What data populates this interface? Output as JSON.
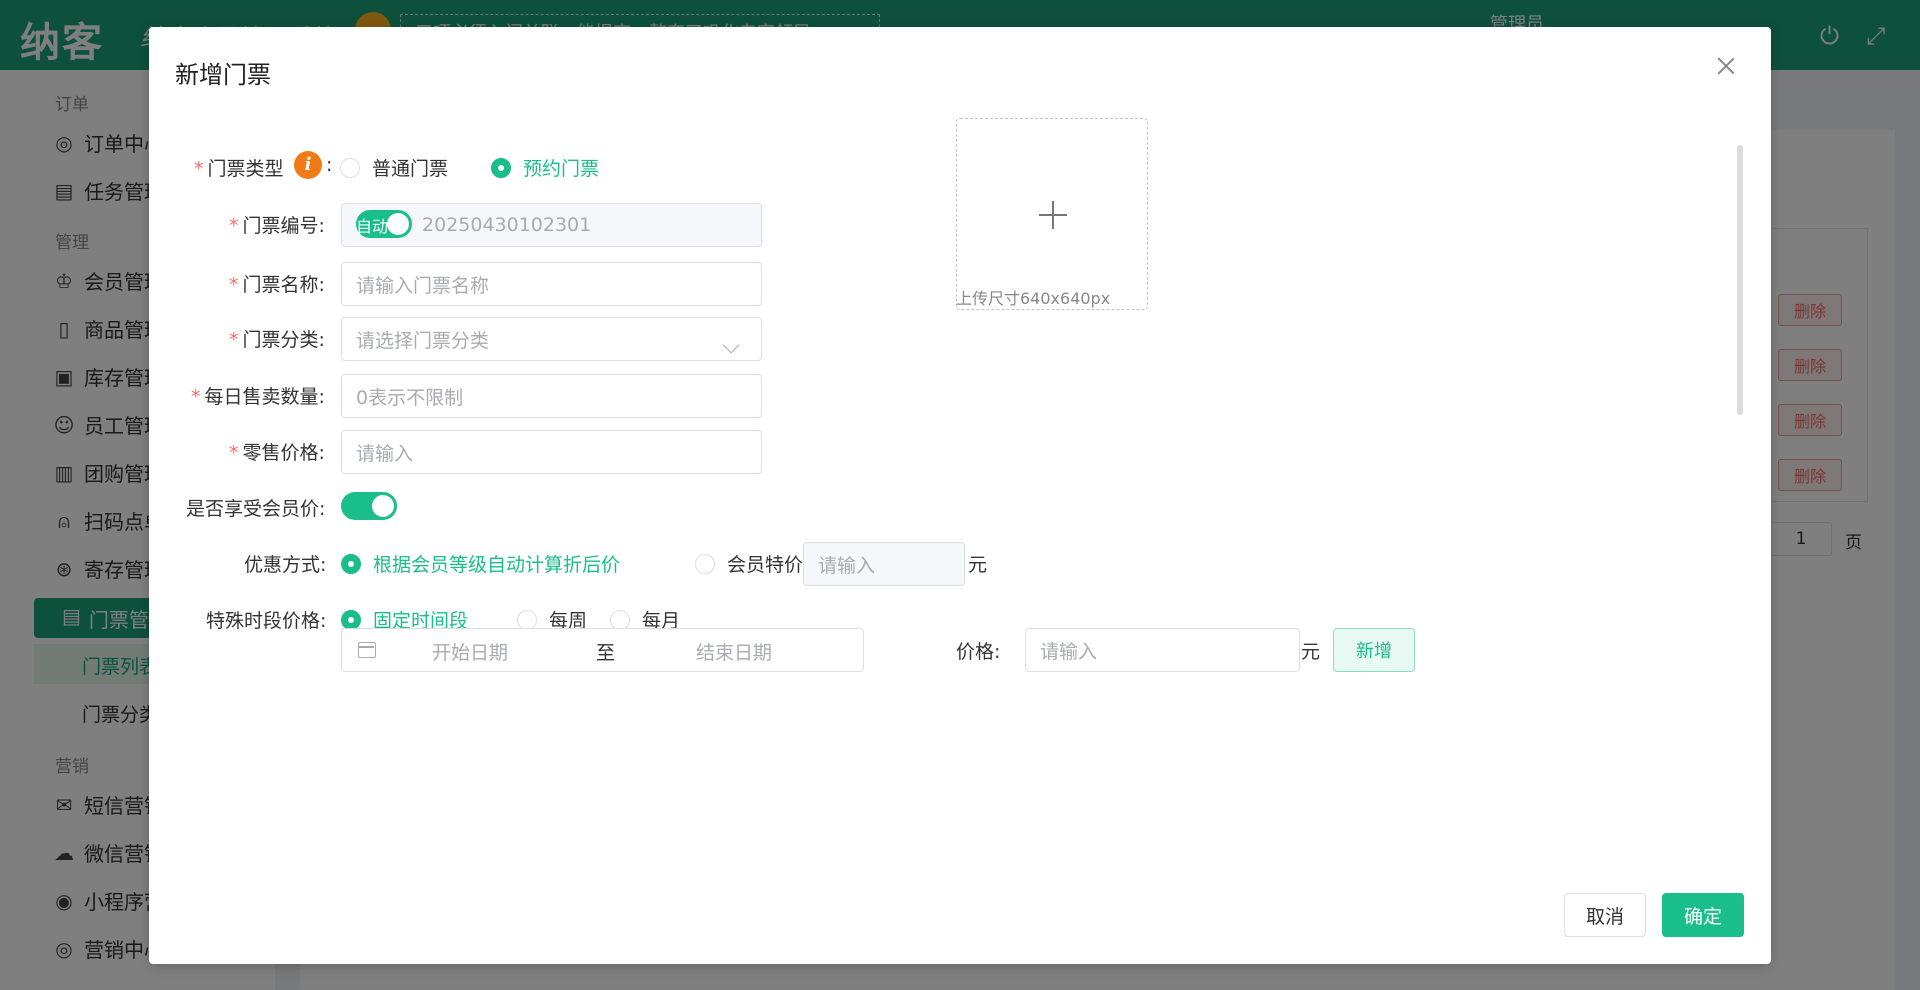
{
  "app": {
    "logo": "纳客",
    "slogan": "纳客会员管理系统",
    "notice": "三项必须入门关联，能提高一整套了巩化专家领导",
    "admin_label": "管理员"
  },
  "sidebar": {
    "groups": [
      "订单",
      "管理",
      "营销"
    ],
    "items": [
      {
        "label": "订单中心",
        "icon": "globe-icon"
      },
      {
        "label": "任务管理",
        "icon": "task-icon"
      },
      {
        "label": "会员管理",
        "icon": "crown-icon"
      },
      {
        "label": "商品管理",
        "icon": "goods-icon"
      },
      {
        "label": "库存管理",
        "icon": "box-icon"
      },
      {
        "label": "员工管理",
        "icon": "user-icon"
      },
      {
        "label": "团购管理",
        "icon": "ticket-icon"
      },
      {
        "label": "扫码点单",
        "icon": "bell-icon"
      },
      {
        "label": "寄存管理",
        "icon": "deposit-icon"
      },
      {
        "label": "门票管理",
        "icon": "ticket-list-icon"
      },
      {
        "label": "短信营销",
        "icon": "mail-icon"
      },
      {
        "label": "微信营销",
        "icon": "wechat-icon"
      },
      {
        "label": "小程序营销",
        "icon": "miniapp-icon"
      },
      {
        "label": "营销中心",
        "icon": "target-icon"
      }
    ],
    "subitems": [
      "门票列表",
      "门票分类"
    ]
  },
  "main": {
    "delete_label": "删除",
    "page_value": "1",
    "page_unit": "页"
  },
  "dialog": {
    "title": "新增门票",
    "ticket_type": {
      "label": "门票类型",
      "options": [
        "普通门票",
        "预约门票"
      ],
      "selected": "预约门票"
    },
    "ticket_no": {
      "label": "门票编号",
      "auto_label": "自动",
      "value": "20250430102301"
    },
    "ticket_name": {
      "label": "门票名称",
      "placeholder": "请输入门票名称"
    },
    "ticket_category": {
      "label": "门票分类",
      "placeholder": "请选择门票分类"
    },
    "daily_quantity": {
      "label": "每日售卖数量",
      "placeholder": "0表示不限制"
    },
    "retail_price": {
      "label": "零售价格",
      "placeholder": "请输入"
    },
    "member_price_toggle": {
      "label": "是否享受会员价",
      "enabled": true
    },
    "discount_method": {
      "label": "优惠方式",
      "options": [
        "根据会员等级自动计算折后价",
        "会员特价"
      ],
      "selected": "根据会员等级自动计算折后价",
      "special_placeholder": "请输入",
      "unit": "元"
    },
    "special_period": {
      "label": "特殊时段价格",
      "options": [
        "固定时间段",
        "每周",
        "每月"
      ],
      "selected": "固定时间段",
      "start_placeholder": "开始日期",
      "separator": "至",
      "end_placeholder": "结束日期",
      "price_label": "价格",
      "price_placeholder": "请输入",
      "unit": "元",
      "add_label": "新增"
    },
    "upload": {
      "tip": "上传尺寸640x640px"
    },
    "cancel_label": "取消",
    "confirm_label": "确定"
  },
  "colors": {
    "brand": "#1aa37a",
    "accent": "#19be8a",
    "required": "#f56c6c",
    "info_icon": "#f07b16"
  }
}
